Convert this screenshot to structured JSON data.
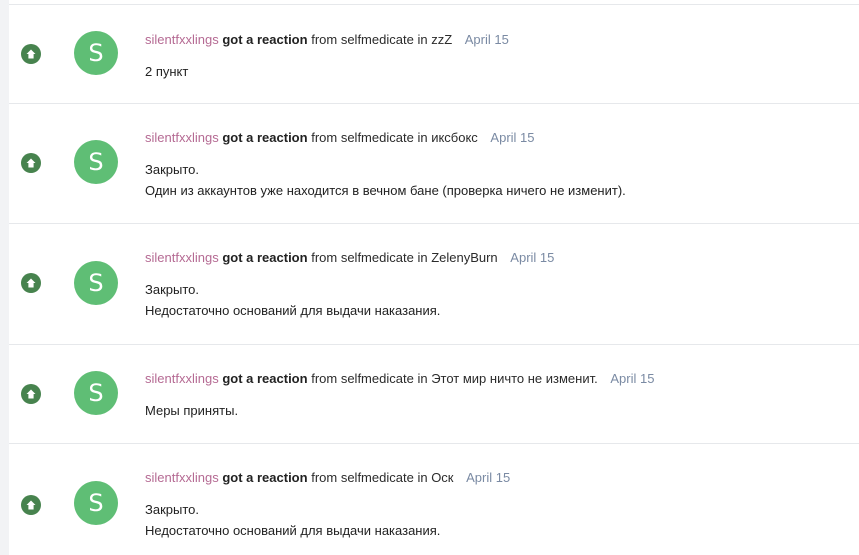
{
  "colors": {
    "username": "#b56a93",
    "date": "#7a8aa3",
    "reaction_badge": "#47834e",
    "avatar_bg": "#5fbe75"
  },
  "alerts": [
    {
      "badge_icon": "arrow-up-icon",
      "avatar_letter": "S",
      "username": "silentfxxlings",
      "action": "got a reaction",
      "from_word": "from",
      "reactor": "selfmedicate",
      "in_word": "in",
      "thread": "zzZ",
      "date": "April 15",
      "lines": [
        "2 пункт",
        ""
      ]
    },
    {
      "badge_icon": "arrow-up-icon",
      "avatar_letter": "S",
      "username": "silentfxxlings",
      "action": "got a reaction",
      "from_word": "from",
      "reactor": "selfmedicate",
      "in_word": "in",
      "thread": "иксбокс",
      "date": "April 15",
      "lines": [
        "Закрыто.",
        "Один из аккаунтов уже находится в вечном бане (проверка ничего не изменит)."
      ]
    },
    {
      "badge_icon": "arrow-up-icon",
      "avatar_letter": "S",
      "username": "silentfxxlings",
      "action": "got a reaction",
      "from_word": "from",
      "reactor": "selfmedicate",
      "in_word": "in",
      "thread": "ZelenyBurn",
      "date": "April 15",
      "lines": [
        "Закрыто.",
        "Недостаточно оснований для выдачи наказания."
      ]
    },
    {
      "badge_icon": "arrow-up-icon",
      "avatar_letter": "S",
      "username": "silentfxxlings",
      "action": "got a reaction",
      "from_word": "from",
      "reactor": "selfmedicate",
      "in_word": "in",
      "thread": "Этот мир ничто не изменит.",
      "date": "April 15",
      "lines": [
        "Меры приняты.",
        ""
      ]
    },
    {
      "badge_icon": "arrow-up-icon",
      "avatar_letter": "S",
      "username": "silentfxxlings",
      "action": "got a reaction",
      "from_word": "from",
      "reactor": "selfmedicate",
      "in_word": "in",
      "thread": "Оск",
      "date": "April 15",
      "lines": [
        "Закрыто.",
        "Недостаточно оснований для выдачи наказания."
      ]
    }
  ]
}
